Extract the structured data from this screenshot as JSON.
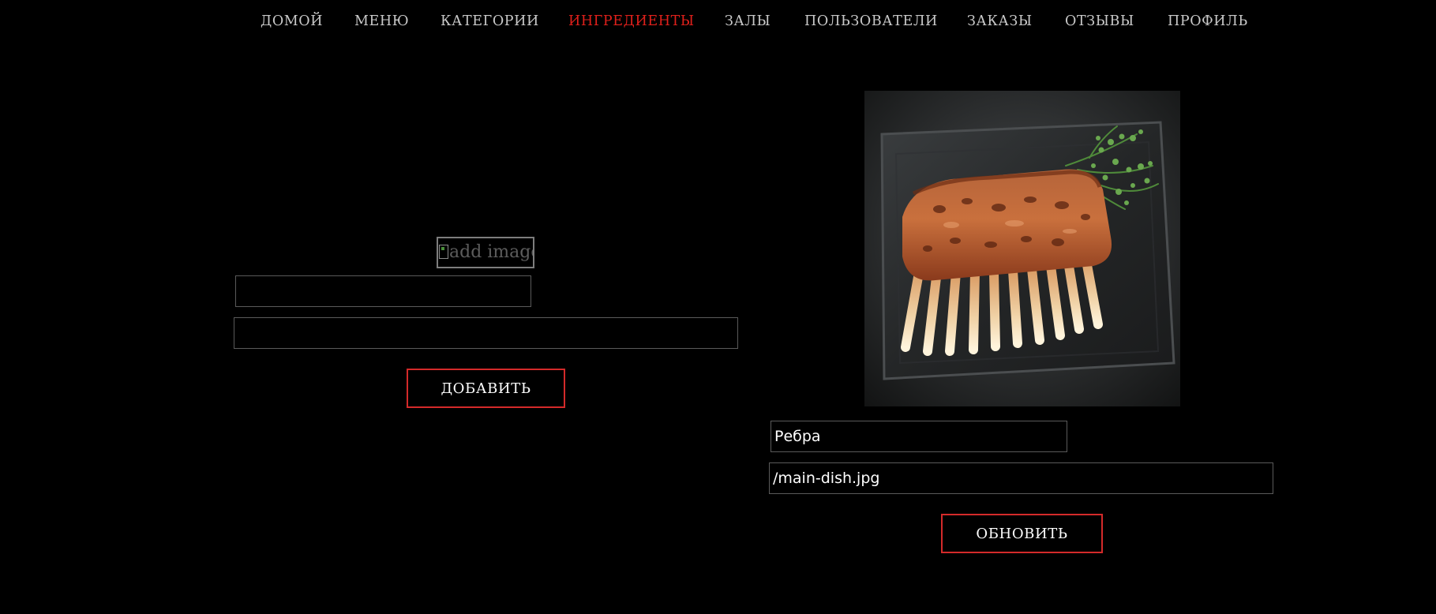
{
  "nav": {
    "items": [
      {
        "label": "ДОМОЙ",
        "active": false
      },
      {
        "label": "МЕНЮ",
        "active": false
      },
      {
        "label": "КАТЕГОРИИ",
        "active": false
      },
      {
        "label": "ИНГРЕДИЕНТЫ",
        "active": true
      },
      {
        "label": "ЗАЛЫ",
        "active": false
      },
      {
        "label": "ПОЛЬЗОВАТЕЛИ",
        "active": false
      },
      {
        "label": "ЗАКАЗЫ",
        "active": false
      },
      {
        "label": "ОТЗЫВЫ",
        "active": false
      },
      {
        "label": "ПРОФИЛЬ",
        "active": false
      }
    ],
    "color": "#c9c9c9",
    "active_color": "#e0201b"
  },
  "add_form": {
    "image_alt": "add image",
    "name_value": "",
    "image_path_value": "",
    "submit_label": "ДОБАВИТЬ"
  },
  "edit_form": {
    "image_subject": "grilled rack of ribs on slate board with thyme",
    "name_value": "Ребра",
    "image_path_value": "/main-dish.jpg",
    "submit_label": "ОБНОВИТЬ"
  },
  "colors": {
    "background": "#000000",
    "accent": "#d42a2a",
    "field_border": "#5a5a5a"
  }
}
